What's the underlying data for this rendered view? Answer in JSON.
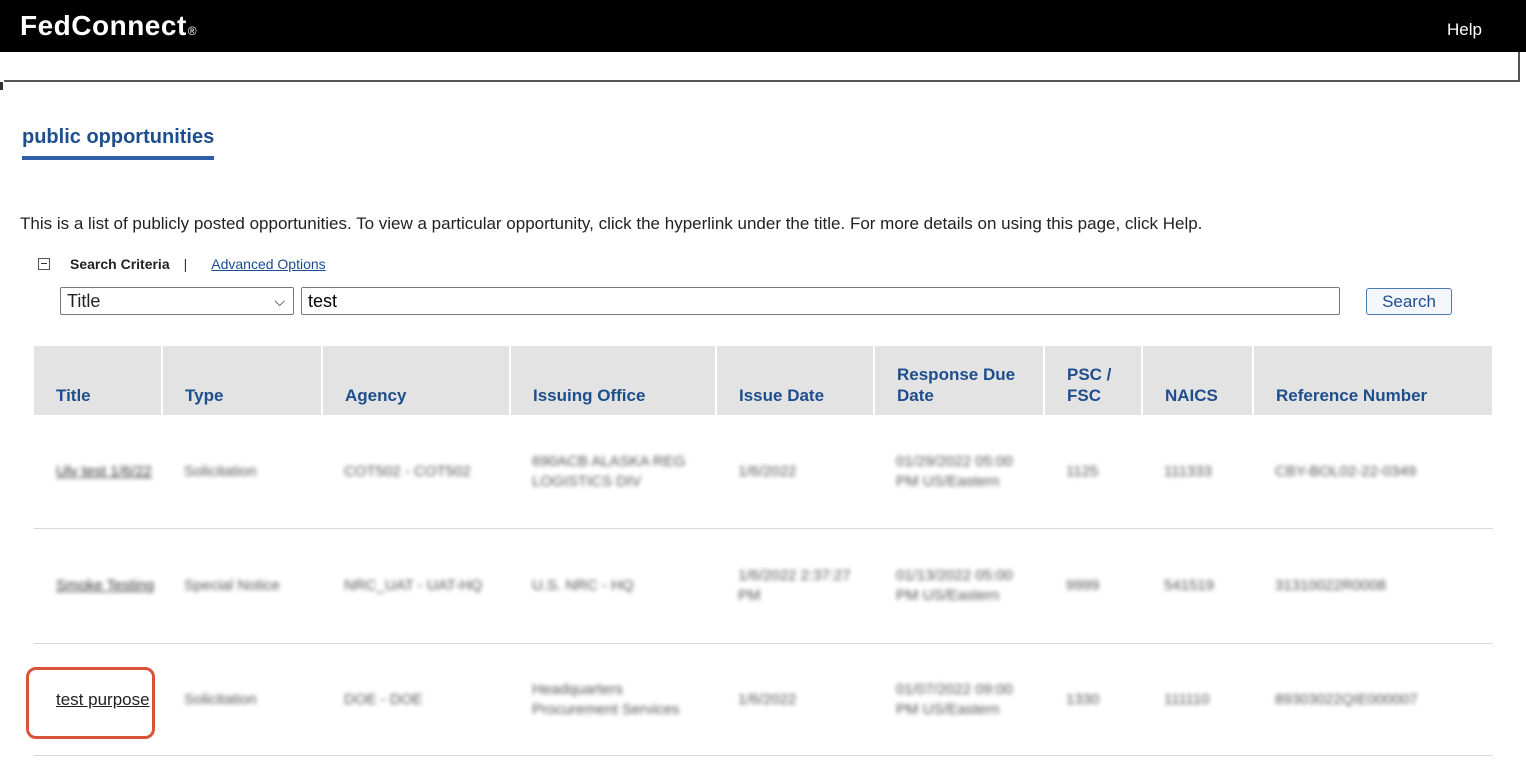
{
  "header": {
    "brand": "FedConnect",
    "brand_mark": "®",
    "help_label": "Help"
  },
  "page": {
    "section_title": "public opportunities",
    "intro": "This is a list of publicly posted opportunities. To view a particular opportunity, click the hyperlink under the title. For more details on using this page, click Help."
  },
  "search": {
    "criteria_label": "Search Criteria",
    "separator": "|",
    "advanced_label": "Advanced Options",
    "field_selected": "Title",
    "query": "test",
    "button_label": "Search"
  },
  "table": {
    "headers": [
      "Title",
      "Type",
      "Agency",
      "Issuing Office",
      "Issue Date",
      "Response Due Date",
      "PSC / FSC",
      "NAICS",
      "Reference Number"
    ],
    "rows": [
      {
        "title": "Ulv test 1/6/22",
        "type": "Solicitation",
        "agency": "COT502 - COT502",
        "office": "690ACB ALASKA REG LOGISTICS DIV",
        "issue_date": "1/6/2022",
        "due_date": "01/29/2022 05:00 PM US/Eastern",
        "psc": "1125",
        "naics": "111333",
        "reference": "CBY-BOL02-22-0349"
      },
      {
        "title": "Smoke Testing",
        "type": "Special Notice",
        "agency": "NRC_UAT - UAT-HQ",
        "office": "U.S. NRC - HQ",
        "issue_date": "1/6/2022 2:37:27 PM",
        "due_date": "01/13/2022 05:00 PM US/Eastern",
        "psc": "9999",
        "naics": "541519",
        "reference": "31310022R0008"
      },
      {
        "title": "test purpose",
        "type": "Solicitation",
        "agency": "DOE - DOE",
        "office": "Headquarters Procurement Services",
        "issue_date": "1/6/2022",
        "due_date": "01/07/2022 09:00 PM US/Eastern",
        "psc": "1330",
        "naics": "111110",
        "reference": "89303022QIE000007"
      }
    ]
  },
  "colors": {
    "accent": "#1f4e8c",
    "highlight": "#d9533a"
  }
}
